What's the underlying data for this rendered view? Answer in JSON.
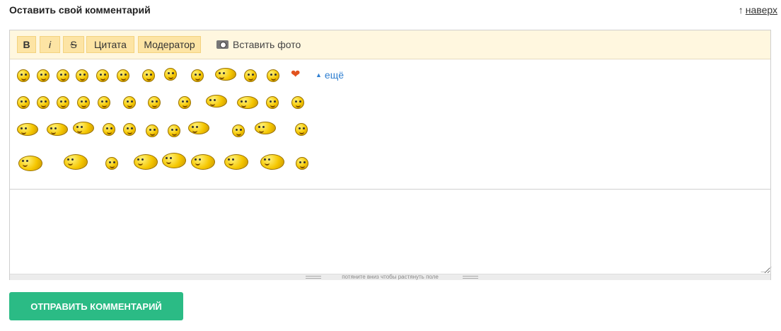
{
  "header": {
    "title": "Оставить свой комментарий",
    "top_arrow": "↑",
    "top_link": "наверх"
  },
  "toolbar": {
    "bold": "B",
    "italic": "i",
    "strike": "S",
    "quote": "Цитата",
    "moderator": "Модератор",
    "insert_photo": "Вставить фото"
  },
  "smileys": {
    "more_label": "ещё"
  },
  "textarea": {
    "value": "",
    "placeholder": "",
    "stretch_hint": "потяните вниз чтобы растянуть поле"
  },
  "submit": {
    "label": "ОТПРАВИТЬ КОММЕНТАРИЙ"
  },
  "colors": {
    "accent": "#2bbb85",
    "toolbar_bg": "#fff7df",
    "button_bg": "#fde4a4",
    "link": "#2f7fd1"
  }
}
